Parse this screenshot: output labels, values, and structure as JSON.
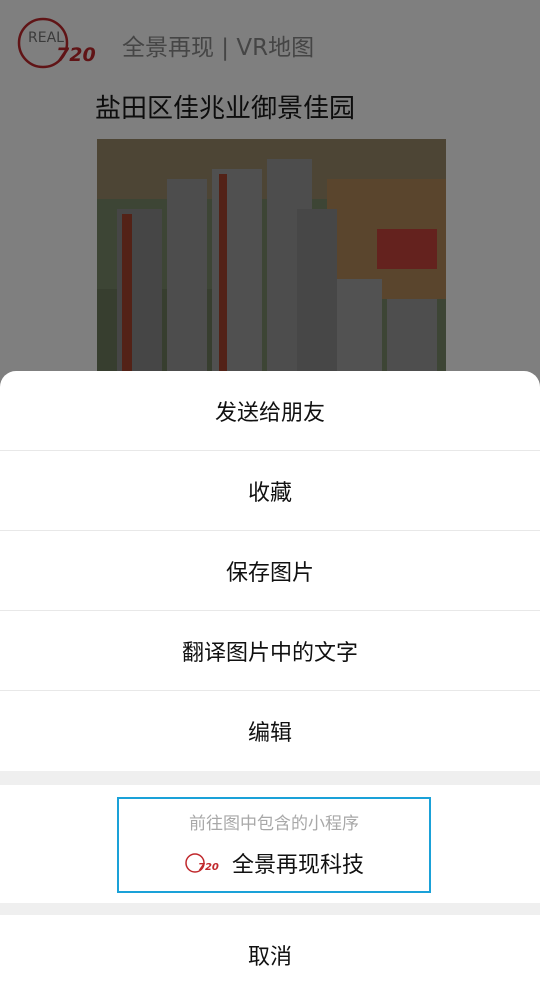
{
  "header": {
    "logo_text_top": "REAL",
    "logo_text_bottom": "720",
    "brand": "全景再现 | VR地图"
  },
  "article": {
    "title": "盐田区佳兆业御景佳园"
  },
  "menu": {
    "items": [
      {
        "label": "发送给朋友"
      },
      {
        "label": "收藏"
      },
      {
        "label": "保存图片"
      },
      {
        "label": "翻译图片中的文字"
      },
      {
        "label": "编辑"
      }
    ],
    "miniprogram": {
      "hint": "前往图中包含的小程序",
      "name": "全景再现科技",
      "logo_text": "720"
    },
    "cancel": "取消"
  },
  "colors": {
    "accent_border": "#1aa1d8",
    "logo_red": "#c0282c"
  }
}
